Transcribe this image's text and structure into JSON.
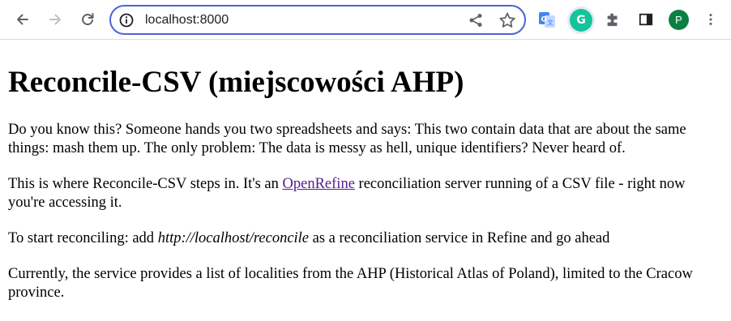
{
  "browser": {
    "url": "localhost:8000",
    "icons": {
      "back": "arrow-left-icon",
      "forward": "arrow-right-icon",
      "reload": "reload-icon",
      "site_info": "site-info-icon",
      "share": "share-icon",
      "bookmark": "star-icon",
      "translate": "google-translate-icon",
      "grammarly": "grammarly-icon",
      "extensions": "puzzle-icon",
      "side_panel": "side-panel-icon",
      "menu": "more-vert-icon"
    },
    "grammarly_letter": "G",
    "profile_initial": "P",
    "colors": {
      "omnibox_border": "#4d63d6",
      "profile_bg": "#0b8043",
      "grammarly_bg": "#15c39a",
      "link": "#551a8b"
    }
  },
  "page": {
    "title": "Reconcile-CSV (miejscowości AHP)",
    "p1": "Do you know this? Someone hands you two spreadsheets and says: This two contain data that are about the same things: mash them up. The only problem: The data is messy as hell, unique identifiers? Never heard of.",
    "p2_before": "This is where Reconcile-CSV steps in. It's an ",
    "p2_link": "OpenRefine",
    "p2_after": " reconciliation server running of a CSV file - right now you're accessing it.",
    "p3_before": "To start reconciling: add ",
    "p3_em": "http://localhost/reconcile",
    "p3_after": " as a reconciliation service in Refine and go ahead",
    "p4": "Currently, the service provides a list of localities from the AHP (Historical Atlas of Poland), limited to the Cracow province."
  }
}
